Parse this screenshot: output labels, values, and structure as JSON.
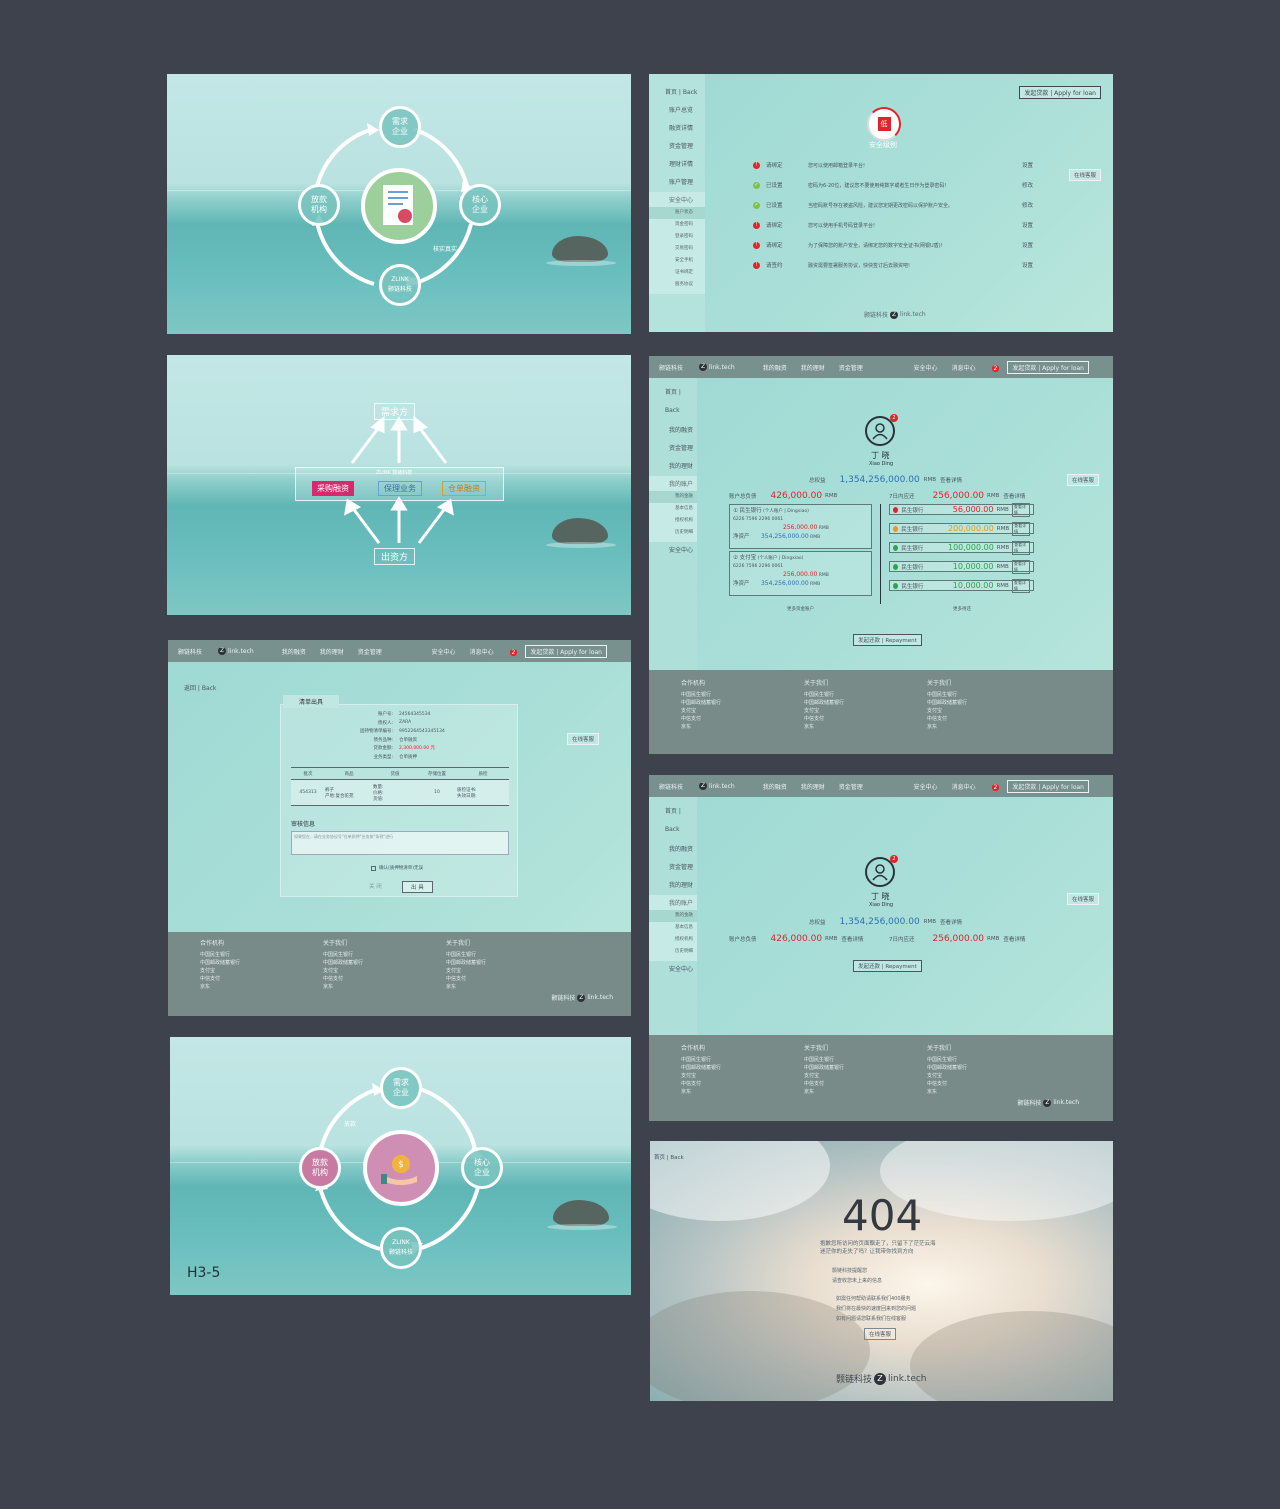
{
  "p1": {
    "nodes": {
      "top": "需求\n企业",
      "right": "核心\n企业",
      "left": "放款\n机构",
      "bottom": "ZLINK\n颢链科技"
    },
    "annotation": "核实真实"
  },
  "p2": {
    "nav": {
      "home": "首页 | Back",
      "items": [
        "账户总览",
        "融资详情",
        "资金管理",
        "理财详情",
        "账户管理"
      ],
      "security_center": "安全中心",
      "sub_items": [
        "账户状态",
        "资金密码",
        "登录密码",
        "交易密码",
        "安全手机",
        "证书绑定",
        "服务协议"
      ]
    },
    "apply_button": "发起贷款 | Apply for loan",
    "service": "在线客服",
    "shield_label": "低",
    "security_title": "安全级别",
    "rows": [
      {
        "status": "warn",
        "state": "请绑定",
        "desc": "您可以使用邮箱登录平台!",
        "action": "设置"
      },
      {
        "status": "ok",
        "state": "已设置",
        "desc": "密码为6-20位，建议您不要使用纯数字或者生日作为登录密码!",
        "action": "修改"
      },
      {
        "status": "ok",
        "state": "已设置",
        "desc": "当密码账号存在被盗风险，建议您定期更改密码以保护账户安全。",
        "action": "修改"
      },
      {
        "status": "warn",
        "state": "请绑定",
        "desc": "您可以使用手机号码登录平台!",
        "action": "设置"
      },
      {
        "status": "warn",
        "state": "请绑定",
        "desc": "为了保障您的账户安全，请绑定您的数字安全证书(网银U盾)!",
        "action": "设置"
      },
      {
        "status": "warn",
        "state": "请签约",
        "desc": "融资需要签署服务协议，快快签订后去融资吧!",
        "action": "设置"
      }
    ],
    "footer_logo": "颢链科技",
    "footer_logo2": "link.tech"
  },
  "p3": {
    "top": "需求方",
    "center_title": "ZLINK 颢链科技",
    "tags": [
      "采购融资",
      "保理业务",
      "仓单融资"
    ],
    "bottom": "出资方"
  },
  "p4": {
    "nav": {
      "logo": "颢链科技",
      "logo2": "link.tech",
      "items": [
        "我的融资",
        "我的理财",
        "资金管理"
      ],
      "security": "安全中心",
      "msg": "消息中心",
      "msg_count": "2",
      "apply": "发起贷款 | Apply for loan"
    },
    "side": {
      "home": "首页 | Back",
      "items": [
        "我的融资",
        "资金管理",
        "我的理财",
        "我的账户"
      ],
      "sub_items": [
        "我的金融",
        "基本信息",
        "授权机构",
        "历史明细"
      ],
      "security": "安全中心"
    },
    "service": "在线客服",
    "user": {
      "name": "丁 晓",
      "pinyin": "Xiao Ding",
      "badge": "2"
    },
    "total_label": "总权益",
    "total": "1,354,256,000.00",
    "rmb": "RMB",
    "detail": "查看详情",
    "liab_label": "账户总负债",
    "liab": "426,000.00",
    "due_label": "7日内应还",
    "due": "256,000.00",
    "accounts": [
      {
        "name": "① 民生银行",
        "type": "(个人账户 | Dingxiao)",
        "acct": "6226 7596 2296 0061",
        "amount": "256,000.00",
        "net_label": "净资产",
        "net": "354,256,000.00"
      },
      {
        "name": "② 支付宝",
        "type": "(个人账户 | Dingxiao)",
        "acct": "6226 7596 2296 0061",
        "amount": "256,000.00",
        "net_label": "净资产",
        "net": "354,256,000.00"
      }
    ],
    "more_left": "更多资金账户",
    "banks": [
      {
        "name": "民生银行",
        "amount": "56,000.00",
        "color": "#e1232a"
      },
      {
        "name": "民生银行",
        "amount": "200,000.00",
        "color": "#e79a14"
      },
      {
        "name": "民生银行",
        "amount": "100,000.00",
        "color": "#2aa54c"
      },
      {
        "name": "民生银行",
        "amount": "10,000.00",
        "color": "#2aa54c"
      },
      {
        "name": "民生银行",
        "amount": "10,000.00",
        "color": "#2aa54c"
      }
    ],
    "more_right": "更多待还",
    "repay": "发起还款 | Repayment",
    "footer_cols": [
      {
        "title": "合作机构",
        "items": [
          "中国民生银行",
          "中国邮政储蓄银行",
          "支付宝",
          "中信支付",
          "京东"
        ]
      },
      {
        "title": "关于我们",
        "items": [
          "中国民生银行",
          "中国邮政储蓄银行",
          "支付宝",
          "中信支付",
          "京东"
        ]
      },
      {
        "title": "关于我们",
        "items": [
          "中国民生银行",
          "中国邮政储蓄银行",
          "支付宝",
          "中信支付",
          "京东"
        ]
      }
    ]
  },
  "p5": {
    "back": "返回 | Back",
    "tab": "清单出具",
    "fields": [
      {
        "label": "账户号:",
        "value": "24564345534"
      },
      {
        "label": "债权人:",
        "value": "ZARA"
      },
      {
        "label": "固持物清单编号:",
        "value": "9952264543345134"
      },
      {
        "label": "债务品种:",
        "value": "仓单融资"
      },
      {
        "label": "贷款金额:",
        "value": "2,300,000.00  元"
      },
      {
        "label": "业务类型:",
        "value": "仓单质押"
      }
    ],
    "table_headers": [
      "批次",
      "商品",
      "货值",
      "存储位置",
      "质检"
    ],
    "table_row": [
      "454313",
      "裤子\n产地:复合驼苑",
      "数量:\n价格:\n货值:",
      "10",
      "质检证书:\n失效日期:"
    ],
    "review_title": "审核信息",
    "review_placeholder": "如果您在...请在业务协议号\"仓单质押\"业务按\"条例\"进行",
    "confirm": "确认(质押物清单)无误",
    "buttons": [
      "关 闭",
      "出 具"
    ],
    "service": "在线客服",
    "footer_cols": [
      {
        "title": "合作机构",
        "items": [
          "中国民生银行",
          "中国邮政储蓄银行",
          "支付宝",
          "中信支付",
          "京东"
        ]
      },
      {
        "title": "关于我们",
        "items": [
          "中国民生银行",
          "中国邮政储蓄银行",
          "支付宝",
          "中信支付",
          "京东"
        ]
      },
      {
        "title": "关于我们",
        "items": [
          "中国民生银行",
          "中国邮政储蓄银行",
          "支付宝",
          "中信支付",
          "京东"
        ]
      }
    ]
  },
  "p6": {
    "user": {
      "name": "丁 晓",
      "pinyin": "Xiao Ding",
      "badge": "2"
    },
    "total_label": "总权益",
    "total": "1,354,256,000.00",
    "liab_label": "账户总负债",
    "liab": "426,000.00",
    "due_label": "7日内应还",
    "due": "256,000.00",
    "repay": "发起还款 | Repayment"
  },
  "p7": {
    "nodes": {
      "top": "需求\n企业",
      "right": "核心\n企业",
      "left": "放款\n机构",
      "bottom": "ZLINK\n颢链科技"
    },
    "annotation": "放款",
    "label": "H3-5"
  },
  "p8": {
    "back": "首页 | Back",
    "code": "404",
    "msg1": "抱歉您所访问的页面飘走了，只留下了茫茫云海",
    "msg2": "迷茫你的走失了吗？让我带你找到方向",
    "lines": [
      "颢链科技提醒您",
      "请查收您未上来的信息",
      "如需任何帮助请联系我们400服务",
      "我们将在最快的速度回来到您的问题",
      "如有问题请您联系我们在线客服"
    ],
    "service": "在线客服",
    "logo": "颢链科技",
    "logo2": "link.tech"
  }
}
